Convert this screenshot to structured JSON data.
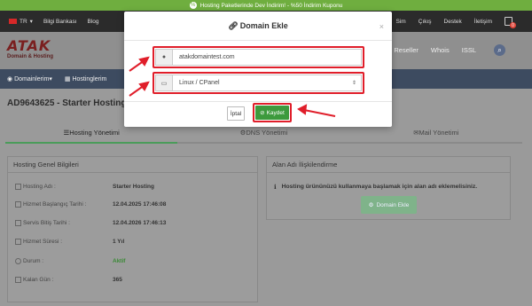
{
  "promo": {
    "icon": "percent-icon",
    "text": "Hosting Paketlerinde Dev İndirim! - %50 İndirim Kuponu"
  },
  "topbar": {
    "lang": "TR",
    "links_left": [
      "Bilgi Bankası",
      "Blog"
    ],
    "links_right": [
      "Sim",
      "Çıkış",
      "Destek",
      "İletişim"
    ],
    "cart_count": "0"
  },
  "logo": {
    "name": "ATAK",
    "subtitle": "Domain & Hosting"
  },
  "header_nav": [
    "Reseller",
    "Whois",
    "ISSL"
  ],
  "main_nav": [
    "Domainlerim",
    "Hostinglerim"
  ],
  "page_title": "AD9643625 - Starter Hosting",
  "tabs": [
    {
      "label": "Hosting Yönetimi",
      "icon": "list-icon",
      "active": true
    },
    {
      "label": "DNS Yönetimi",
      "icon": "gear-icon",
      "active": false
    },
    {
      "label": "Mail Yönetimi",
      "icon": "envelope-icon",
      "active": false
    }
  ],
  "hosting_info": {
    "title": "Hosting Genel Bilgileri",
    "rows": [
      {
        "label": "Hosting Adı :",
        "value": "Starter Hosting",
        "icon": "list-icon"
      },
      {
        "label": "Hizmet Başlangıç Tarihi :",
        "value": "12.04.2025 17:46:08",
        "icon": "calendar-icon"
      },
      {
        "label": "Servis Bitiş Tarihi :",
        "value": "12.04.2026 17:46:13",
        "icon": "calendar-icon"
      },
      {
        "label": "Hizmet Süresi :",
        "value": "1 Yıl",
        "icon": "hourglass-icon"
      },
      {
        "label": "Durum :",
        "value": "Aktif",
        "icon": "circle-check-icon"
      },
      {
        "label": "Kalan Gün :",
        "value": "365",
        "icon": "calendar-icon"
      }
    ]
  },
  "domain_panel": {
    "title": "Alan Adı İlişkilendirme",
    "message": "Hosting ürününüzü kullanmaya başlamak için alan adı eklemelisiniz.",
    "button_label": "Domain Ekle"
  },
  "modal": {
    "title": "Domain Ekle",
    "close": "×",
    "domain_value": "atakdomaintest.com",
    "os_value": "Linux / CPanel",
    "cancel_label": "İptal",
    "save_label": "Kaydet"
  },
  "colors": {
    "accent_green": "#3d9a3d",
    "highlight_red": "#e01e2a",
    "overlay": "#9a9a9a"
  }
}
